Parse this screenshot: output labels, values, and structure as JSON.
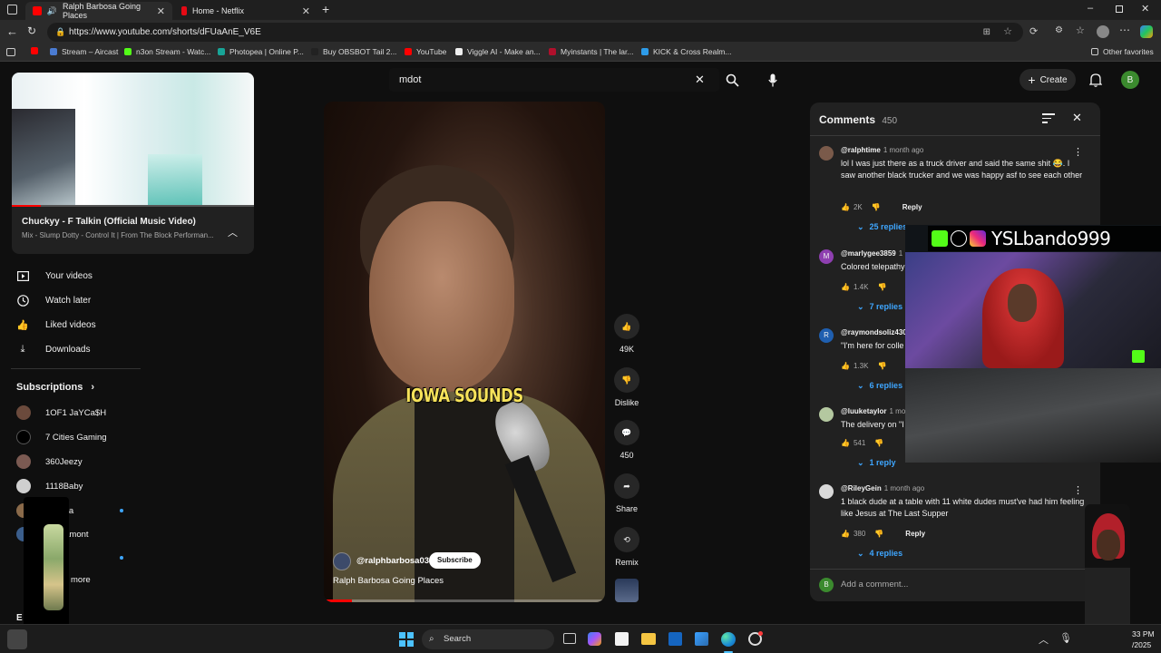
{
  "browser": {
    "tabs": [
      {
        "title": "Ralph Barbosa Going Places",
        "active": true
      },
      {
        "title": "Home - Netflix",
        "active": false
      }
    ],
    "url": "https://www.youtube.com/shorts/dFUaAnE_V6E",
    "bookmarks": [
      "Stream – Aircast",
      "n3on Stream - Watc...",
      "Photopea | Online P...",
      "Buy OBSBOT Tail 2...",
      "YouTube",
      "Viggle AI - Make an...",
      "Myinstants | The lar...",
      "KICK & Cross Realm..."
    ],
    "other_favorites": "Other favorites"
  },
  "youtube": {
    "search_value": "mdot",
    "create_label": "Create",
    "avatar_letter": "B",
    "miniplayer": {
      "title": "Chuckyy - F Talkin (Official Music Video)",
      "subtitle": "Mix - Slump Dotty - Control It | From The Block Performan..."
    },
    "nav": [
      "Your videos",
      "Watch later",
      "Liked videos",
      "Downloads"
    ],
    "subscriptions_label": "Subscriptions",
    "subscriptions": [
      "1OF1 JaYCa$H",
      "7 Cities Gaming",
      "360Jeezy",
      "1118Baby",
      "crruzza",
      "dandamont"
    ],
    "show_more": "more",
    "footer_letter": "E",
    "video": {
      "caption": "IOWA SOUNDS",
      "channel": "@ralphbarbosa03",
      "subscribe": "Subscribe",
      "title": "Ralph Barbosa Going Places",
      "progress": 0.1
    },
    "actions": {
      "likes": "49K",
      "dislike": "Dislike",
      "comments": "450",
      "share": "Share",
      "remix": "Remix"
    },
    "comments_panel": {
      "title": "Comments",
      "count": "450",
      "add_placeholder": "Add a comment...",
      "add_avatar": "B",
      "items": [
        {
          "handle": "@ralphtime",
          "ago": "1 month ago",
          "text": "lol I was just there as a truck driver and said the same shit 😂. I saw another black trucker and we was happy asf to see each other",
          "likes": "2K",
          "reply": "Reply",
          "replies": "25 replies"
        },
        {
          "handle": "@marlygee3859",
          "ago": "1",
          "text": "Colored telepathy",
          "likes": "1.4K",
          "reply": "",
          "replies": "7 replies",
          "avatar_letter": "M"
        },
        {
          "handle": "@raymondsoliz430",
          "ago": "",
          "text": "\"I'm here for colle",
          "likes": "1.3K",
          "reply": "",
          "replies": "6 replies",
          "avatar_letter": "R"
        },
        {
          "handle": "@luuketaylor",
          "ago": "1 mo",
          "text": "The delivery on \"I",
          "likes": "541",
          "reply": "",
          "replies": "1 reply"
        },
        {
          "handle": "@RileyGein",
          "ago": "1 month ago",
          "text": "1 black dude at a table with 11 white dudes must've had him feeling like Jesus at The Last Supper",
          "likes": "380",
          "reply": "Reply",
          "replies": "4 replies"
        }
      ]
    }
  },
  "stream_overlay": {
    "username": "YSLbando999"
  },
  "taskbar": {
    "search": "Search",
    "time": "33 PM",
    "date": "/2025"
  },
  "colors": {
    "bg": "#0f0f0f",
    "panel": "#212121",
    "link_blue": "#3ea6ff",
    "caption_yellow": "#f6e25a",
    "youtube_red": "#ff0000"
  }
}
